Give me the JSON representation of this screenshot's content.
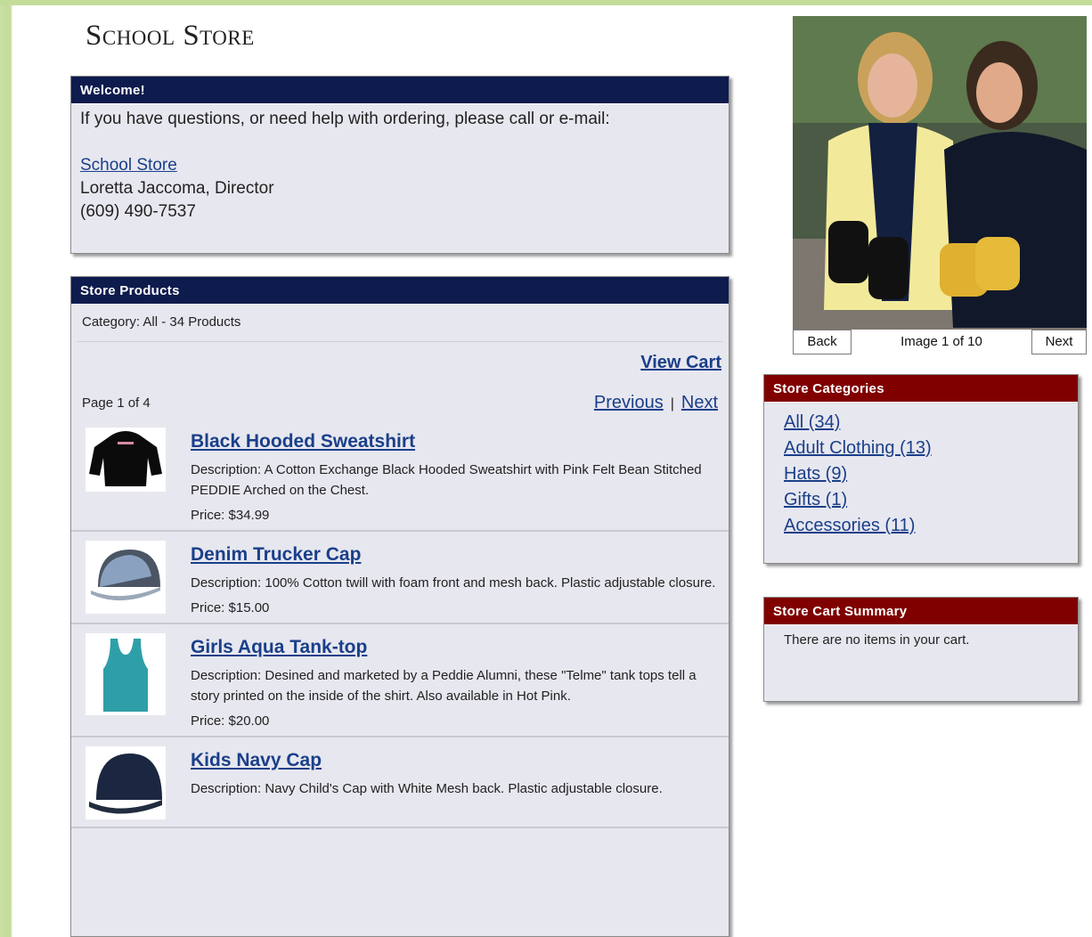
{
  "site": {
    "title": "School Store"
  },
  "welcome": {
    "header": "Welcome!",
    "intro": "If you have questions, or need help with ordering, please call or e-mail:",
    "store_link": "School Store",
    "director": "Loretta Jaccoma, Director",
    "phone": "(609) 490-7537"
  },
  "products": {
    "header": "Store Products",
    "category": "Category: All - 34 Products",
    "view_cart": "View Cart",
    "page": "Page 1 of 4",
    "previous": "Previous",
    "separator": "|",
    "next": "Next",
    "items": [
      {
        "name": "Black Hooded Sweatshirt",
        "description": "Description: A Cotton Exchange Black Hooded Sweatshirt with Pink Felt Bean Stitched PEDDIE Arched on the Chest.",
        "price": "Price: $34.99"
      },
      {
        "name": "Denim Trucker Cap",
        "description": "Description: 100% Cotton twill with foam front and mesh back. Plastic adjustable closure.",
        "price": "Price: $15.00"
      },
      {
        "name": "Girls Aqua Tank-top",
        "description": "Description: Desined and marketed by a Peddie Alumni, these \"Telme\" tank tops tell a story printed on the inside of the shirt. Also available in Hot Pink.",
        "price": "Price: $20.00"
      },
      {
        "name": "Kids Navy Cap",
        "description": "Description: Navy Child's Cap with White Mesh back. Plastic adjustable closure.",
        "price": ""
      }
    ]
  },
  "gallery": {
    "back": "Back",
    "counter": "Image 1 of 10",
    "next": "Next"
  },
  "categories": {
    "header": "Store Categories",
    "items": [
      "All (34)",
      "Adult Clothing (13)",
      "Hats (9)",
      "Gifts (1)",
      "Accessories (11)"
    ]
  },
  "cart": {
    "header": "Store Cart Summary",
    "empty": "There are no items in your cart."
  },
  "colors": {
    "navy": "#0e1b4d",
    "maroon": "#800000",
    "link": "#1a3f8a",
    "panel": "#e7e7ef"
  }
}
